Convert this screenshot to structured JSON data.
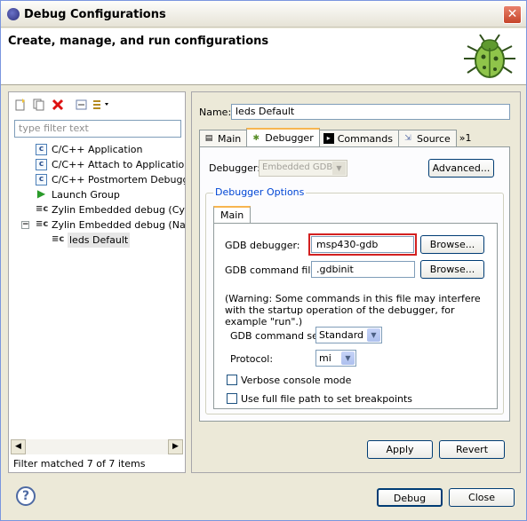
{
  "window": {
    "title": "Debug Configurations",
    "close_symbol": "✕"
  },
  "header": {
    "heading": "Create, manage, and run configurations"
  },
  "left": {
    "filter_placeholder": "type filter text",
    "tree": [
      {
        "label": "C/C++ Application",
        "icon": "c-config-icon"
      },
      {
        "label": "C/C++ Attach to Application",
        "icon": "c-config-icon"
      },
      {
        "label": "C/C++ Postmortem Debugger",
        "icon": "c-config-icon"
      },
      {
        "label": "Launch Group",
        "icon": "launch-group-icon"
      },
      {
        "label": "Zylin Embedded debug (Cygwin)",
        "icon": "zylin-icon"
      },
      {
        "label": "Zylin Embedded debug (Native)",
        "icon": "zylin-icon"
      },
      {
        "label": "leds Default",
        "icon": "zylin-icon"
      }
    ],
    "status": "Filter matched 7 of 7 items"
  },
  "right": {
    "name_label": "Name:",
    "name_value": "leds Default",
    "tabs": [
      {
        "label": "Main",
        "icon": "main-tab-icon"
      },
      {
        "label": "Debugger",
        "icon": "debugger-tab-icon"
      },
      {
        "label": "Commands",
        "icon": "commands-tab-icon"
      },
      {
        "label": "Source",
        "icon": "source-tab-icon"
      },
      {
        "label": "»1",
        "icon": ""
      }
    ],
    "debugger_label": "Debugger:",
    "debugger_value": "Embedded GDB",
    "advanced_button": "Advanced...",
    "group_title": "Debugger Options",
    "inner_tab": "Main",
    "gdb_debugger_label": "GDB debugger:",
    "gdb_debugger_value": "msp430-gdb",
    "browse_label": "Browse...",
    "gdb_command_file_label": "GDB command file:",
    "gdb_command_file_value": ".gdbinit",
    "warning": "(Warning: Some commands in this file may interfere with the startup operation of the debugger, for example \"run\".)",
    "command_set_label": "GDB command set:",
    "command_set_value": "Standard",
    "protocol_label": "Protocol:",
    "protocol_value": "mi",
    "verbose_label": "Verbose console mode",
    "fullpath_label": "Use full file path to set breakpoints",
    "apply_button": "Apply",
    "revert_button": "Revert"
  },
  "footer": {
    "debug_button": "Debug",
    "close_button": "Close",
    "help_symbol": "?"
  }
}
